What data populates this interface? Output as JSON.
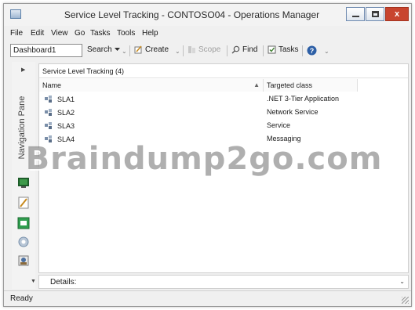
{
  "window": {
    "title": "Service Level Tracking - CONTOSO04 - Operations Manager",
    "close_label": "x"
  },
  "menu": [
    "File",
    "Edit",
    "View",
    "Go",
    "Tasks",
    "Tools",
    "Help"
  ],
  "toolbar": {
    "scope_value": "Dashboard1",
    "search_label": "Search",
    "create_label": "Create",
    "scope_label": "Scope",
    "find_label": "Find",
    "tasks_label": "Tasks"
  },
  "navigation": {
    "pane_label": "Navigation Pane"
  },
  "content": {
    "header": "Service Level Tracking (4)",
    "columns": [
      "Name",
      "Targeted class"
    ],
    "rows": [
      {
        "name": "SLA1",
        "targeted_class": ".NET 3-Tier Application"
      },
      {
        "name": "SLA2",
        "targeted_class": "Network Service"
      },
      {
        "name": "SLA3",
        "targeted_class": "Service"
      },
      {
        "name": "SLA4",
        "targeted_class": "Messaging"
      }
    ]
  },
  "details": {
    "label": "Details:"
  },
  "status": {
    "text": "Ready"
  },
  "watermark": "Braindump2go.com",
  "icons": {
    "app": "operations-manager-icon",
    "sla": "sla-icon",
    "search": "search-dropdown-icon",
    "create": "create-icon",
    "scope": "scope-icon",
    "find": "find-icon",
    "tasks": "tasks-icon",
    "help": "help-icon"
  },
  "colors": {
    "close_button": "#c8452f",
    "window_border": "#9a9a9a"
  }
}
